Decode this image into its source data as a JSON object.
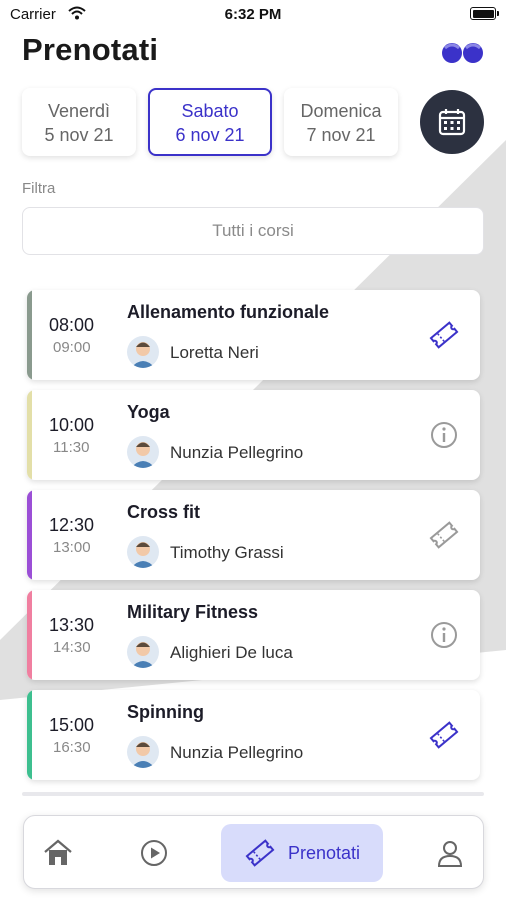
{
  "status_bar": {
    "carrier": "Carrier",
    "time": "6:32 PM"
  },
  "header": {
    "title": "Prenotati"
  },
  "days": [
    {
      "name": "Venerdì",
      "date": "5 nov 21",
      "selected": false
    },
    {
      "name": "Sabato",
      "date": "6 nov 21",
      "selected": true
    },
    {
      "name": "Domenica",
      "date": "7 nov 21",
      "selected": false
    }
  ],
  "filter": {
    "label": "Filtra",
    "value": "Tutti i corsi"
  },
  "classes": [
    {
      "start": "08:00",
      "end": "09:00",
      "title": "Allenamento funzionale",
      "trainer": "Loretta Neri",
      "color": "#8a9a8e",
      "action": "ticket-icon",
      "action_color": "#3b32c9"
    },
    {
      "start": "10:00",
      "end": "11:30",
      "title": "Yoga",
      "trainer": "Nunzia Pellegrino",
      "color": "#e3dfa8",
      "action": "info-icon",
      "action_color": "#9a9a9a"
    },
    {
      "start": "12:30",
      "end": "13:00",
      "title": "Cross fit",
      "trainer": "Timothy Grassi",
      "color": "#9b4fd6",
      "action": "ticket-icon",
      "action_color": "#9a9a9a"
    },
    {
      "start": "13:30",
      "end": "14:30",
      "title": "Military Fitness",
      "trainer": "Alighieri De luca",
      "color": "#f07fa0",
      "action": "info-icon",
      "action_color": "#9a9a9a"
    },
    {
      "start": "15:00",
      "end": "16:30",
      "title": "Spinning",
      "trainer": "Nunzia Pellegrino",
      "color": "#3dbf8f",
      "action": "ticket-icon",
      "action_color": "#3b32c9"
    }
  ],
  "tabbar": {
    "active_label": "Prenotati"
  },
  "colors": {
    "accent": "#3b32c9",
    "calendar_button": "#2c3140",
    "active_tab_bg": "#d8dcfb",
    "background_stripe": "#e0e0e0"
  }
}
